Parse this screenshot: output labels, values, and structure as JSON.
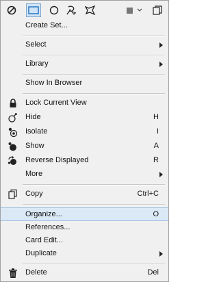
{
  "menu": {
    "items": {
      "create_set": {
        "label": "Create Set..."
      },
      "select": {
        "label": "Select"
      },
      "library": {
        "label": "Library"
      },
      "show_in_browser": {
        "label": "Show In Browser"
      },
      "lock_current_view": {
        "label": "Lock Current View"
      },
      "hide": {
        "label": "Hide",
        "shortcut": "H"
      },
      "isolate": {
        "label": "Isolate",
        "shortcut": "I"
      },
      "show": {
        "label": "Show",
        "shortcut": "A"
      },
      "reverse_displayed": {
        "label": "Reverse Displayed",
        "shortcut": "R"
      },
      "more": {
        "label": "More"
      },
      "copy": {
        "label": "Copy",
        "shortcut": "Ctrl+C"
      },
      "organize": {
        "label": "Organize...",
        "shortcut": "O"
      },
      "references": {
        "label": "References..."
      },
      "card_edit": {
        "label": "Card Edit..."
      },
      "duplicate": {
        "label": "Duplicate"
      },
      "delete": {
        "label": "Delete",
        "shortcut": "Del"
      }
    }
  },
  "icons": {
    "toolbar": [
      "no-symbol-icon",
      "rectangle-select-icon",
      "circle-select-icon",
      "lasso-select-icon",
      "polygon-select-icon",
      "color-swatch-icon",
      "dropdown-arrow-icon",
      "copy-window-icon"
    ],
    "accent": "#1e6fc0",
    "highlight": "#dbe9f7"
  }
}
